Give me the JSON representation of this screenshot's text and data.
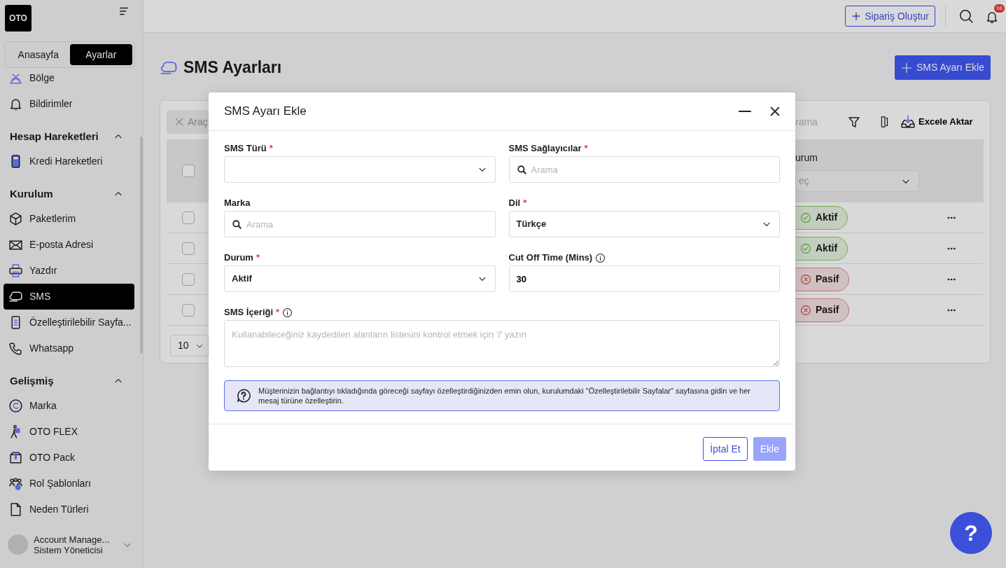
{
  "sidebar": {
    "logo": "OTO",
    "tabs": [
      {
        "label": "Anasayfa",
        "selected": false
      },
      {
        "label": "Ayarlar",
        "selected": true
      }
    ],
    "sections": [
      {
        "items": [
          {
            "label": "Bölge",
            "selected": false
          },
          {
            "label": "Bildirimler",
            "selected": false
          }
        ]
      },
      {
        "title": "Hesap Hareketleri",
        "expanded": true,
        "items": [
          {
            "label": "Kredi Hareketleri",
            "selected": false
          }
        ]
      },
      {
        "title": "Kurulum",
        "expanded": true,
        "items": [
          {
            "label": "Paketlerim",
            "selected": false
          },
          {
            "label": "E-posta Adresi",
            "selected": false
          },
          {
            "label": "Yazdır",
            "selected": false
          },
          {
            "label": "SMS",
            "selected": true
          },
          {
            "label": "Özelleştirilebilir Sayfa...",
            "selected": false
          },
          {
            "label": "Whatsapp",
            "selected": false
          }
        ]
      },
      {
        "title": "Gelişmiş",
        "expanded": true,
        "items": [
          {
            "label": "Marka",
            "selected": false
          },
          {
            "label": "OTO FLEX",
            "selected": false
          },
          {
            "label": "OTO Pack",
            "selected": false
          },
          {
            "label": "Rol Şablonları",
            "selected": false
          },
          {
            "label": "Neden Türleri",
            "selected": false
          }
        ]
      }
    ],
    "user": {
      "name": "Account Manage...",
      "role": "Sistem Yöneticisi"
    }
  },
  "topbar": {
    "create_button": "Sipariş Oluştur",
    "notification_count": "98"
  },
  "page": {
    "title": "SMS Ayarları",
    "add_button": "SMS Ayarı Ekle"
  },
  "table": {
    "tools_button": "Araç",
    "search_placeholder": "rama",
    "export_button": "Excele Aktar",
    "header_checked": false,
    "status_column": "urum",
    "status_filter_placeholder": "eç",
    "rows": [
      {
        "checked": false,
        "status": "Aktif",
        "active": true
      },
      {
        "checked": false,
        "status": "Aktif",
        "active": true
      },
      {
        "checked": false,
        "status": "Pasif",
        "active": false
      },
      {
        "checked": false,
        "status": "Pasif",
        "active": false
      }
    ],
    "page_size": "10"
  },
  "modal": {
    "title": "SMS Ayarı Ekle",
    "required_mark": "*",
    "fields": [
      {
        "kind": "select",
        "label": "SMS Türü",
        "required": true,
        "info": false
      },
      {
        "kind": "search",
        "label": "SMS Sağlayıcılar",
        "required": true,
        "info": false,
        "placeholder": "Arama"
      },
      {
        "kind": "search",
        "label": "Marka",
        "required": false,
        "info": false,
        "placeholder": "Arama"
      },
      {
        "kind": "select",
        "label": "Dil",
        "required": true,
        "info": false,
        "value": "Türkçe"
      },
      {
        "kind": "select",
        "label": "Durum",
        "required": true,
        "info": false,
        "value": "Aktif"
      },
      {
        "kind": "text",
        "label": "Cut Off Time (Mins)",
        "required": false,
        "info": true,
        "value": "30"
      },
      {
        "kind": "textarea",
        "label": "SMS İçeriği",
        "required": true,
        "info": true,
        "placeholder": "Kullanabileceğiniz kaydedilen alanların listesini kontrol etmek için '/' yazın"
      }
    ],
    "notice": "Müşterinizin bağlantıyı tıkladığında göreceği sayfayı özelleştirdiğinizden emin olun, kurulumdaki \"Özelleştirilebilir Sayfalar\" sayfasına gidin ve her mesaj türüne özelleştirin.",
    "cancel_button": "İptal Et",
    "submit_button": {
      "label": "Ekle",
      "disabled": true
    }
  },
  "help_button": "?"
}
